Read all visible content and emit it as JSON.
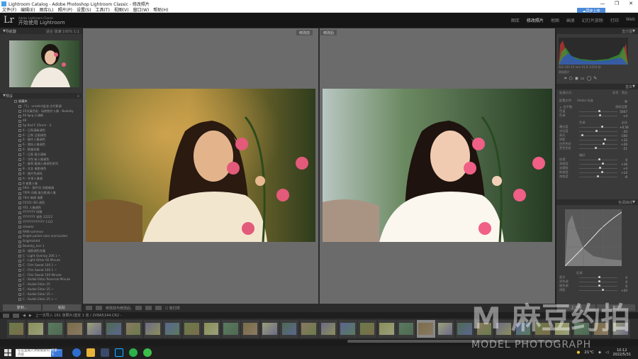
{
  "window": {
    "title": "Lightroom Catalog - Adobe Photoshop Lightroom Classic - 修改照片",
    "controls": [
      "—",
      "❐",
      "✕"
    ]
  },
  "menu": [
    "文件(F)",
    "编辑(E)",
    "图库(L)",
    "照片(P)",
    "设置(S)",
    "工具(T)",
    "视图(V)",
    "窗口(W)",
    "帮助(H)"
  ],
  "cloud_button": "同步上传",
  "identity": {
    "logo": "Lr",
    "small": "Adobe Lightroom Classic",
    "big": "开始使用 Lightroom"
  },
  "modules": [
    {
      "label": "图库",
      "active": false
    },
    {
      "label": "修改照片",
      "active": true
    },
    {
      "label": "地图",
      "active": false
    },
    {
      "label": "画册",
      "active": false
    },
    {
      "label": "幻灯片放映",
      "active": false
    },
    {
      "label": "打印",
      "active": false
    },
    {
      "label": "Web",
      "active": false
    }
  ],
  "left": {
    "navigator": "导航器",
    "nav_options": "适合  填满  100%  1:1",
    "presets_title": "预设",
    "presets": [
      {
        "t": "收藏夹",
        "folder": true
      },
      {
        "t": "「1」 unsetnt出油 古代影调"
      },
      {
        "t": "25次真色彩 · 玩转胶片人像 · Beatsky"
      },
      {
        "t": "4k·lgcg 小清新"
      },
      {
        "t": "4K"
      },
      {
        "t": "5p Red F 35mm - 3"
      },
      {
        "t": "6 - 日系清新调色"
      },
      {
        "t": "6 - 日系 日剧调色"
      },
      {
        "t": "6 - 胶片人像调色"
      },
      {
        "t": "6 - 港风人像调色"
      },
      {
        "t": "6 - 欧美风格"
      },
      {
        "t": "7 - 日系 复古清新"
      },
      {
        "t": "7 - 冷色 新人像调色"
      },
      {
        "t": "7 - 森系 暖调人像调色系列"
      },
      {
        "t": "8 - 文艺 电影调色"
      },
      {
        "t": "9 - 胶片色调风"
      },
      {
        "t": "A - 冬季人像调"
      },
      {
        "t": "B 夜景人像"
      },
      {
        "t": "50m - 胶片风 风格暗调"
      },
      {
        "t": "70Ph 风格 复古影调人像"
      },
      {
        "t": "70m 暗调 电影"
      },
      {
        "t": "F0101 ISO 调色"
      },
      {
        "t": "Y01 人像调色"
      },
      {
        "t": "YYYYYYY 网格"
      },
      {
        "t": "YYYYYYY 调色 22222"
      },
      {
        "t": "YYYYYYYYYYYY 1122"
      },
      {
        "t": "drawlar"
      },
      {
        "t": "RAW-common"
      },
      {
        "t": "Bright pastel color and builder"
      },
      {
        "t": "Brightslidrd"
      },
      {
        "t": "Beatsky_Icer 1"
      },
      {
        "t": "B - 电影调色合集"
      },
      {
        "t": "C - Light Overlay 200 1 ~"
      },
      {
        "t": "C - Light Other 60 Minute"
      },
      {
        "t": "C - Film Sweat 100 1 ~"
      },
      {
        "t": "C - Film Sweat 100 1 ~"
      },
      {
        "t": "C - Film Sweat 100 Minute"
      },
      {
        "t": "C - Kodak Ektar Reversal Minute"
      },
      {
        "t": "C - Kodak Ektar 25"
      },
      {
        "t": "C - Kodak Ektar 25 ~"
      },
      {
        "t": "C - Kodak Ektar 25 ~"
      },
      {
        "t": "C - Kodak Ektar 25 + ~"
      },
      {
        "t": "C - Kodak Ektar 25 + + 1"
      },
      {
        "t": "C - Kodak Portra 160 ~"
      }
    ],
    "btn_copy": "复制...",
    "btn_paste": "粘贴"
  },
  "center": {
    "label_before": "修改前",
    "label_after": "修改后",
    "toolbar_label": "修改前与修改后:",
    "toolbar_soft": "软打样"
  },
  "right": {
    "histogram": "直方图",
    "hist_info": "ISO 100   35 mm   f/1.8   1/250 秒",
    "original": "原始照片",
    "basic": "基本",
    "treatment_label": "处理方式:",
    "treatment_color": "彩色",
    "treatment_bw": "黑白",
    "profile_label": "配置文件:",
    "profile_value": "Adobe 标准",
    "wb_label": "白平衡:",
    "wb_value": "原照设置",
    "section1": [
      {
        "label": "色温",
        "val": "5007",
        "pos": 0.5
      },
      {
        "label": "色调",
        "val": "+4",
        "pos": 0.52
      }
    ],
    "tone_label": "色调",
    "tone_auto": "自动",
    "section2": [
      {
        "label": "曝光度",
        "val": "+0.56",
        "pos": 0.58
      },
      {
        "label": "对比度",
        "val": "-20",
        "pos": 0.42
      },
      {
        "label": "高光",
        "val": "-100",
        "pos": 0.05
      },
      {
        "label": "阴影",
        "val": "+33",
        "pos": 0.65
      },
      {
        "label": "白色色阶",
        "val": "+26",
        "pos": 0.62
      },
      {
        "label": "黑色色阶",
        "val": "-21",
        "pos": 0.4
      }
    ],
    "presence_label": "偏好",
    "section3": [
      {
        "label": "纹理",
        "val": "0",
        "pos": 0.5
      },
      {
        "label": "清晰度",
        "val": "+18",
        "pos": 0.6
      },
      {
        "label": "去朦胧",
        "val": "+4",
        "pos": 0.52
      },
      {
        "label": "鲜艳度",
        "val": "+14",
        "pos": 0.58
      },
      {
        "label": "饱和度",
        "val": "-8",
        "pos": 0.46
      }
    ],
    "tone_curve": "色调曲线",
    "region_label": "区域",
    "section4": [
      {
        "label": "高光",
        "val": "0",
        "pos": 0.5
      },
      {
        "label": "亮色调",
        "val": "0",
        "pos": 0.5
      },
      {
        "label": "暗色调",
        "val": "0",
        "pos": 0.5
      },
      {
        "label": "阴影",
        "val": "+20",
        "pos": 0.6
      }
    ],
    "btn_prev": "上一张",
    "btn_reset": "复位"
  },
  "filmstrip": {
    "source": "上一次导入  161 张照片/选定 1 张 / 2V8A5144.CR2 -",
    "count": 32,
    "selected_index": 21
  },
  "taskbar": {
    "search_placeholder": "在这里输入你要搜索的内容",
    "search_btn": "搜索一下",
    "weather": "21°C",
    "time": "10:12",
    "date": "2022/5/31"
  },
  "watermark": {
    "line1": "M 麻豆约拍",
    "line2": "MODEL PHOTOGRAPH"
  }
}
